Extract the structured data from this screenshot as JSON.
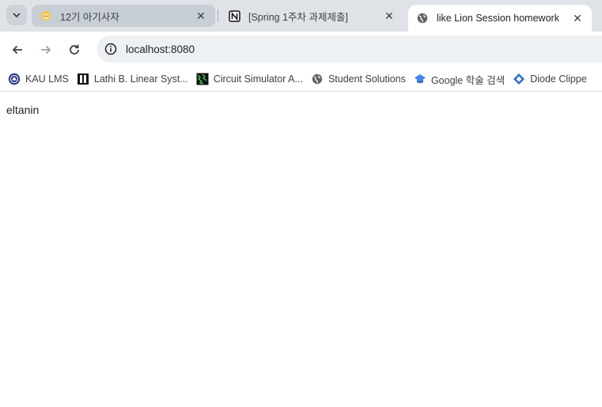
{
  "tabs": [
    {
      "title": "12기 아기사자",
      "favicon": "lion-emoji-icon",
      "active": false
    },
    {
      "title": "[Spring 1주차 과제제출]",
      "favicon": "notion-icon",
      "active": false
    },
    {
      "title": "like Lion Session homework",
      "favicon": "globe-icon",
      "active": true
    }
  ],
  "address": {
    "url": "localhost:8080"
  },
  "bookmarks": [
    {
      "label": "KAU LMS",
      "icon": "university-seal-icon"
    },
    {
      "label": "Lathi B. Linear Syst...",
      "icon": "book-cover-icon"
    },
    {
      "label": "Circuit Simulator A...",
      "icon": "circuit-icon"
    },
    {
      "label": "Student Solutions",
      "icon": "globe-icon"
    },
    {
      "label": "Google 학술 검색",
      "icon": "scholar-cap-icon"
    },
    {
      "label": "Diode Clippe",
      "icon": "diamond-icon"
    }
  ],
  "page": {
    "text": "eltanin"
  },
  "colors": {
    "tabstrip": "#dfe3e8",
    "omnibox": "#eef1f4",
    "active_tab": "#ffffff"
  }
}
